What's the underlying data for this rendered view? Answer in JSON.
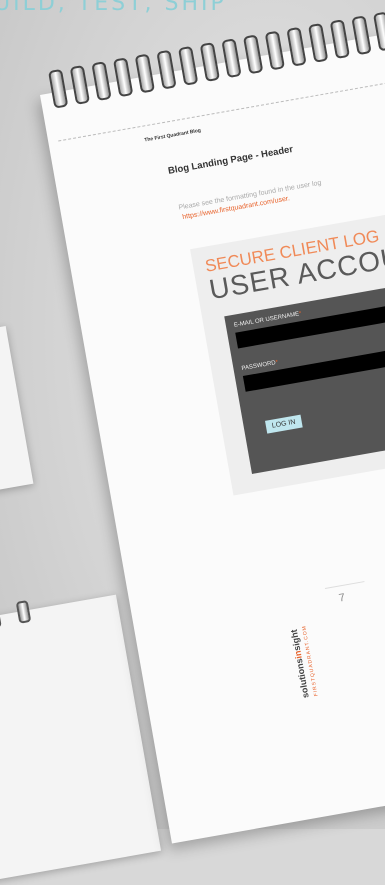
{
  "headline": "UILD, TEST, SHIP",
  "notebook": {
    "blog_label": "The First Quadrant Blog",
    "page_title": "Blog Landing Page - Header",
    "intro_text": "Please see the formatting found in the user log",
    "intro_link": "https://www.firstquadrant.com/user.",
    "card": {
      "subtitle": "SECURE CLIENT LOG",
      "title": "USER ACCOU",
      "email_label": "E-MAIL OR USERNAME",
      "password_label": "PASSWORD",
      "required_mark": "*",
      "login_button": "LOG IN"
    },
    "page_number": "7",
    "logo": {
      "part1": "solutions",
      "part2": "in",
      "part3": "sight",
      "url": "FIRSTQUADRANT.COM"
    }
  },
  "colors": {
    "accent": "#e8632c",
    "headline": "#8ecfd6",
    "form_bg": "#555555",
    "button_bg": "#bfe6ee"
  }
}
